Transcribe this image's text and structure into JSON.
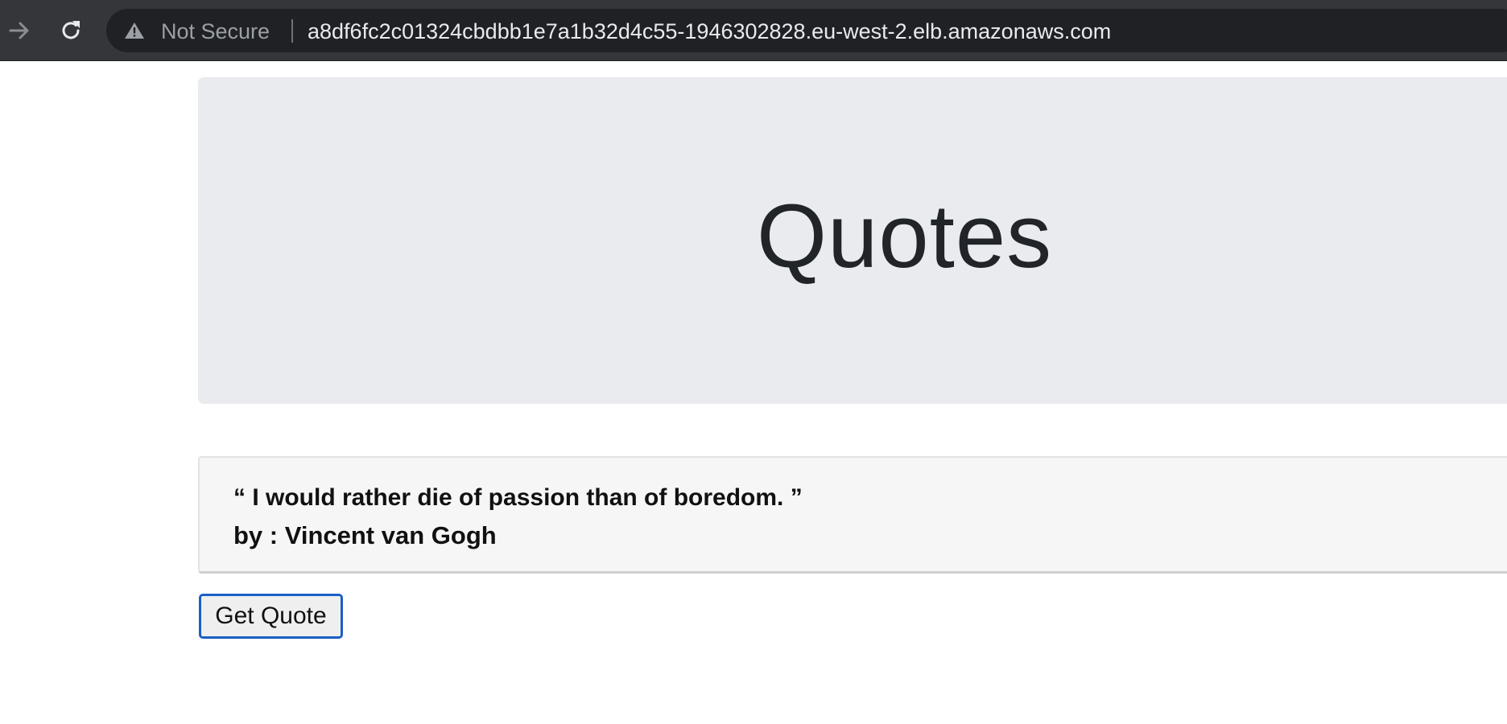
{
  "browser": {
    "security_label": "Not Secure",
    "url": "a8df6fc2c01324cbdbb1e7a1b32d4c55-1946302828.eu-west-2.elb.amazonaws.com",
    "icons": [
      "forward-arrow-icon",
      "reload-icon",
      "warning-triangle-icon"
    ]
  },
  "page": {
    "title": "Quotes",
    "quote": {
      "text": "“ I would rather die of passion than of boredom. ”",
      "author": "by : Vincent van Gogh"
    },
    "button_label": "Get Quote"
  },
  "colors": {
    "jumbotron_background": "#e9ebef",
    "button_border": "#1a5fc4",
    "browser_bar": "#35363a"
  }
}
